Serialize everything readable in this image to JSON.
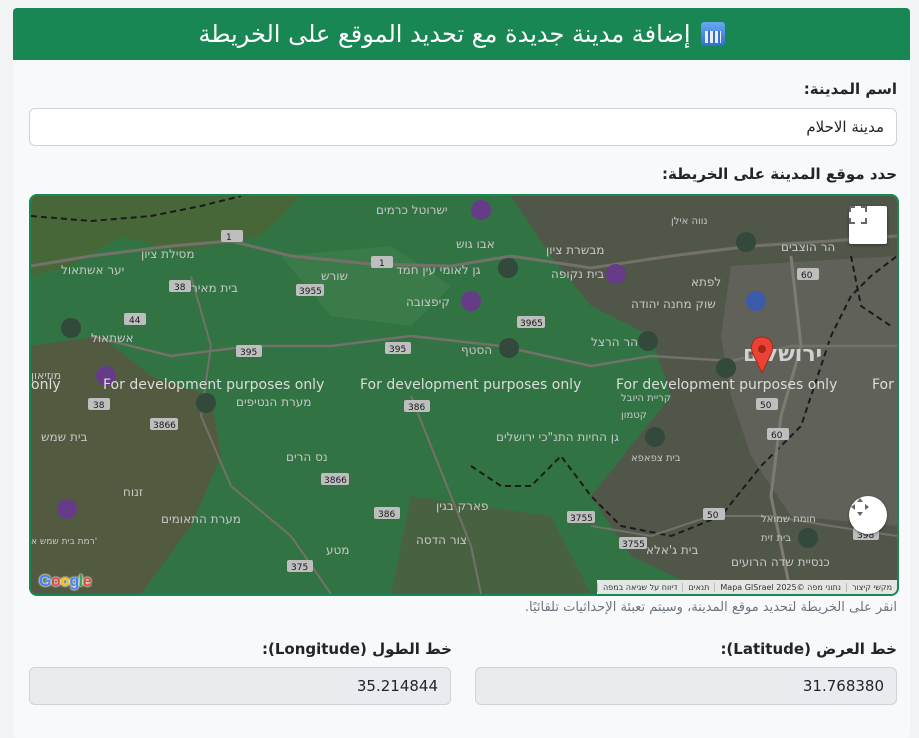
{
  "header": {
    "title": "إضافة مدينة جديدة مع تحديد الموقع على الخريطة",
    "emoji": "cityscape-icon"
  },
  "city": {
    "label": "اسم المدينة:",
    "value": "مدينة الاحلام"
  },
  "map_section": {
    "label": "حدد موقع المدينة على الخريطة:",
    "hint": "انقر على الخريطة لتحديد موقع المدينة، وسيتم تعبئة الإحداثيات تلقائيًا."
  },
  "map": {
    "dev_text": "For development purposes only",
    "dev_fragment_left": "only",
    "dev_fragment_right": "For",
    "logo": "Google",
    "attribution": {
      "shortcuts": "מקשי קיצור",
      "data": "נתוני מפה ©2025 Mapa GISrael",
      "terms": "תנאים",
      "report": "דיווח על שגיאה במפה"
    },
    "places": [
      "ירושלים",
      "ירושלים",
      "לפתא",
      "שוק מחנה יהודה",
      "הר הרצל",
      "קריית היובל",
      "הר הוצבים",
      "נווה אילן",
      "ישרוטל כרמים",
      "אבו גוש",
      "מבשרת ציון",
      "גן לאומי עין חמד",
      "בית נקופה",
      "מסילת ציון",
      "יער אשתאול",
      "בית מאיר",
      "שורש",
      "קיפצובה",
      "הסטף",
      "אשתאול",
      "מוזיאון",
      "מערת הנטיפים",
      "גן החיות התנ\"כי ירושלים",
      "נס הרים",
      "בית שמש",
      "זנוח",
      "מערת התאומים",
      "פארק בגין",
      "צור הדסה",
      "מטע",
      "בית ג'אלא",
      "כנסיית שדה הרועים",
      "רמת בית שמש א'",
      "חומת שמואל",
      "בית צפאפא",
      "קטמון",
      "בית זית"
    ],
    "roads": [
      "1",
      "1",
      "1",
      "38",
      "44",
      "395",
      "395",
      "3955",
      "3965",
      "386",
      "386",
      "3866",
      "3866",
      "38",
      "375",
      "3755",
      "60",
      "60",
      "50",
      "50",
      "398"
    ],
    "fullscreen_icon": "fullscreen-icon",
    "camera_icon": "camera-control-icon",
    "marker_icon": "map-pin-icon"
  },
  "latitude": {
    "label": "خط العرض (Latitude):",
    "value": "31.768380"
  },
  "longitude": {
    "label": "خط الطول (Longitude):",
    "value": "35.214844"
  },
  "colors": {
    "header": "#198754",
    "map_border": "#198754",
    "marker": "#ea4335"
  }
}
